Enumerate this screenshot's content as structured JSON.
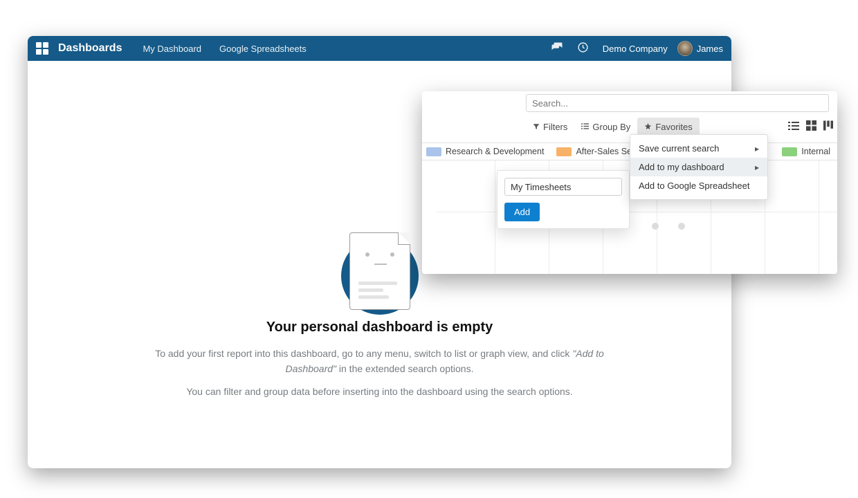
{
  "header": {
    "brand": "Dashboards",
    "menu": {
      "my_dashboard": "My Dashboard",
      "spreadsheets": "Google Spreadsheets"
    },
    "company": "Demo Company",
    "user": "James"
  },
  "empty": {
    "title": "Your personal dashboard is empty",
    "line1a": "To add your first report into this dashboard, go to any menu, switch to list or graph view, and click ",
    "line1b": "\"Add to Dashboard\"",
    "line1c": " in the extended search options.",
    "line2": "You can filter and group data before inserting into the dashboard using the search options."
  },
  "overlay": {
    "search_placeholder": "Search...",
    "filters": "Filters",
    "group_by": "Group By",
    "favorites": "Favorites",
    "chips": {
      "rd": "Research & Development",
      "after_sales": "After-Sales Ser",
      "internal": "Internal"
    },
    "fav_menu": {
      "save": "Save current search",
      "add_dash": "Add to my dashboard",
      "add_sheet": "Add to Google Spreadsheet"
    },
    "add_panel": {
      "value": "My Timesheets",
      "button": "Add"
    },
    "colors": {
      "rd": "#a9c3ea",
      "after_sales": "#f7b267",
      "internal": "#8bd17c"
    }
  }
}
